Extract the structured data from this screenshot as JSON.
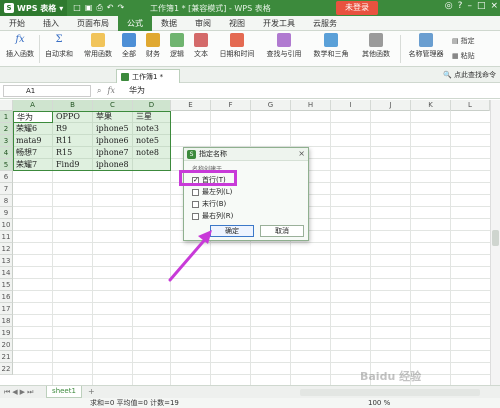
{
  "titlebar": {
    "app_name": "WPS 表格",
    "title": "工作簿1 * [兼容模式] - WPS 表格",
    "login_label": "未登录"
  },
  "menu": {
    "tabs": [
      "开始",
      "插入",
      "页面布局",
      "公式",
      "数据",
      "审阅",
      "视图",
      "开发工具",
      "云服务"
    ],
    "active_tab": "公式"
  },
  "ribbon": {
    "insert_function": "插入函数",
    "autosum": "自动求和",
    "common_functions": "常用函数",
    "all": "全部",
    "finance": "财务",
    "logic": "逻辑",
    "text": "文本",
    "datetime": "日期和时间",
    "lookup": "查找与引用",
    "math": "数学和三角",
    "other": "其他函数",
    "name_manager": "名称管理器",
    "specify": "指定",
    "paste": "粘贴"
  },
  "docbar": {
    "tab_label": "工作簿1 *",
    "find_command": "点此查找命令"
  },
  "formula": {
    "cell_ref": "A1",
    "fx": "fx",
    "value": "华为"
  },
  "grid": {
    "columns": [
      "A",
      "B",
      "C",
      "D",
      "E",
      "F",
      "G",
      "H",
      "I",
      "J",
      "K",
      "L"
    ],
    "rows": [
      "1",
      "2",
      "3",
      "4",
      "5",
      "6",
      "7",
      "8",
      "9",
      "10",
      "11",
      "12",
      "13",
      "14",
      "15",
      "16",
      "17",
      "18",
      "19",
      "20",
      "21",
      "22"
    ],
    "cells": [
      [
        "华为",
        "OPPO",
        "苹果",
        "三星"
      ],
      [
        "荣耀6",
        "R9",
        "iphone5",
        "note3"
      ],
      [
        "mata9",
        "R11",
        "iphone6",
        "note5"
      ],
      [
        "畅想7",
        "R15",
        "iphone7",
        "note8"
      ],
      [
        "荣耀7",
        "Find9",
        "iphone8",
        ""
      ]
    ]
  },
  "dialog": {
    "title": "指定名称",
    "caption": "名称创建于",
    "options": [
      {
        "label": "首行(T)",
        "checked": true
      },
      {
        "label": "最左列(L)",
        "checked": false
      },
      {
        "label": "末行(B)",
        "checked": false
      },
      {
        "label": "最右列(R)",
        "checked": false
      }
    ],
    "ok_label": "确定",
    "cancel_label": "取消"
  },
  "sheetbar": {
    "sheet_name": "sheet1",
    "add": "+"
  },
  "statusbar": {
    "stats": "求和=0  平均值=0  计数=19",
    "zoom": "100 %"
  },
  "colors": {
    "brand_green": "#3c8a3c",
    "highlight_magenta": "#c83ad8",
    "login_red": "#e8523f"
  },
  "watermark": "Baidu 经验"
}
